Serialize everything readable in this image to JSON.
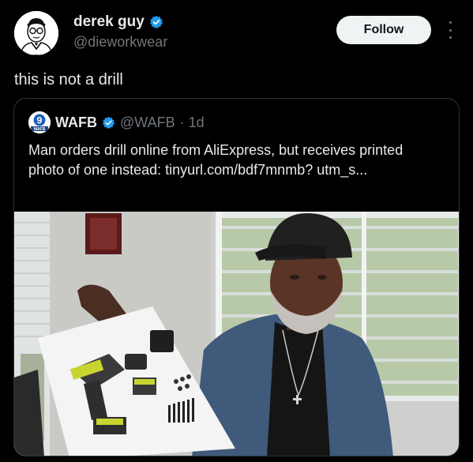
{
  "author": {
    "name": "derek guy",
    "handle": "@dieworkwear",
    "verified": true,
    "avatar_icon": "cartoon-portrait-avatar"
  },
  "follow_label": "Follow",
  "tweet_text": "this is not a drill",
  "quoted": {
    "name": "WAFB",
    "handle": "@WAFB",
    "time": "· 1d",
    "verified": true,
    "logo_label": "WAFB",
    "text": "Man orders drill online from AliExpress, but receives printed photo of one instead: tinyurl.com/bdf7mnmb? utm_s..."
  },
  "colors": {
    "background": "#000000",
    "text": "#e7e9ea",
    "muted": "#71767b",
    "verified": "#1d9bf0",
    "border": "#2f3336",
    "drill_accent": "#c8d430"
  }
}
